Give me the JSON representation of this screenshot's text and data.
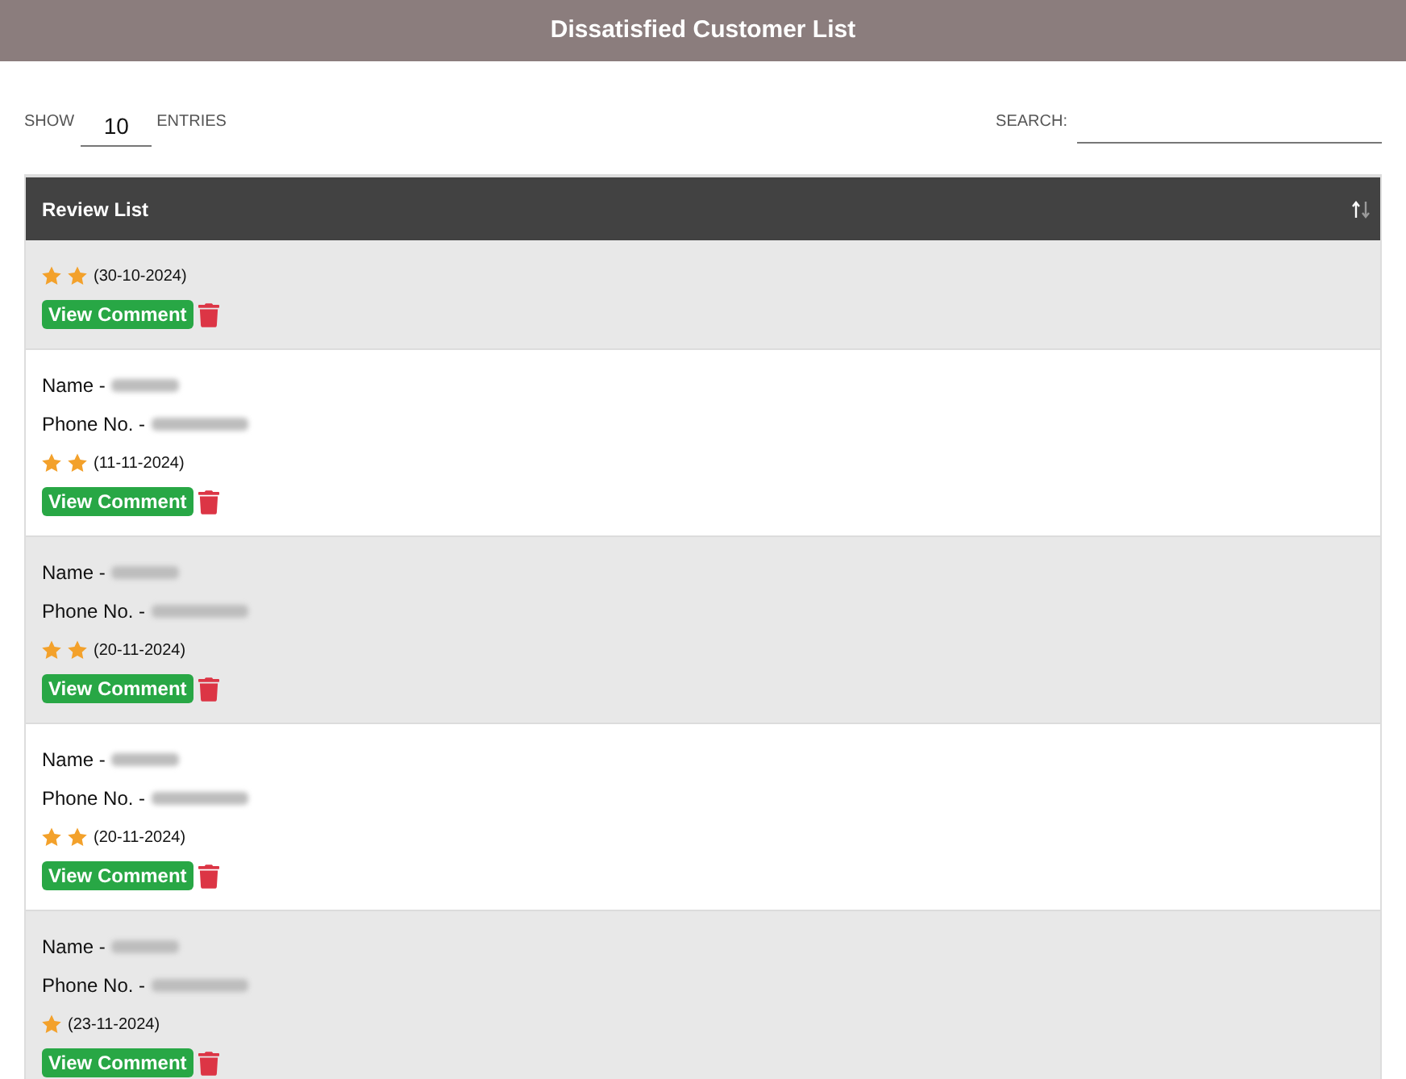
{
  "header": {
    "title": "Dissatisfied Customer List"
  },
  "show_entries": {
    "label": "SHOW",
    "value": "10",
    "suffix": "ENTRIES"
  },
  "search": {
    "label": "SEARCH:"
  },
  "table": {
    "column": "Review List",
    "rows": [
      {
        "kind": "rating",
        "rating": [
          {
            "filled": true
          },
          {
            "filled": true
          }
        ],
        "date": "(30-10-2024)",
        "button": "View Comment"
      },
      {
        "kind": "contact",
        "name_label": "Name -",
        "phone_label": "Phone No. -",
        "rating": [
          {
            "filled": true
          },
          {
            "filled": true
          }
        ],
        "date": "(11-11-2024)",
        "button": "View Comment"
      },
      {
        "kind": "contact",
        "name_label": "Name -",
        "phone_label": "Phone No. -",
        "rating": [
          {
            "filled": true
          },
          {
            "filled": true
          }
        ],
        "date": "(20-11-2024)",
        "button": "View Comment"
      },
      {
        "kind": "contact",
        "name_label": "Name -",
        "phone_label": "Phone No. -",
        "rating": [
          {
            "filled": true
          },
          {
            "filled": true
          }
        ],
        "date": "(20-11-2024)",
        "button": "View Comment"
      },
      {
        "kind": "contact",
        "name_label": "Name -",
        "phone_label": "Phone No. -",
        "rating": [
          {
            "filled": true
          }
        ],
        "date": "(23-11-2024)",
        "button": "View Comment"
      }
    ]
  }
}
